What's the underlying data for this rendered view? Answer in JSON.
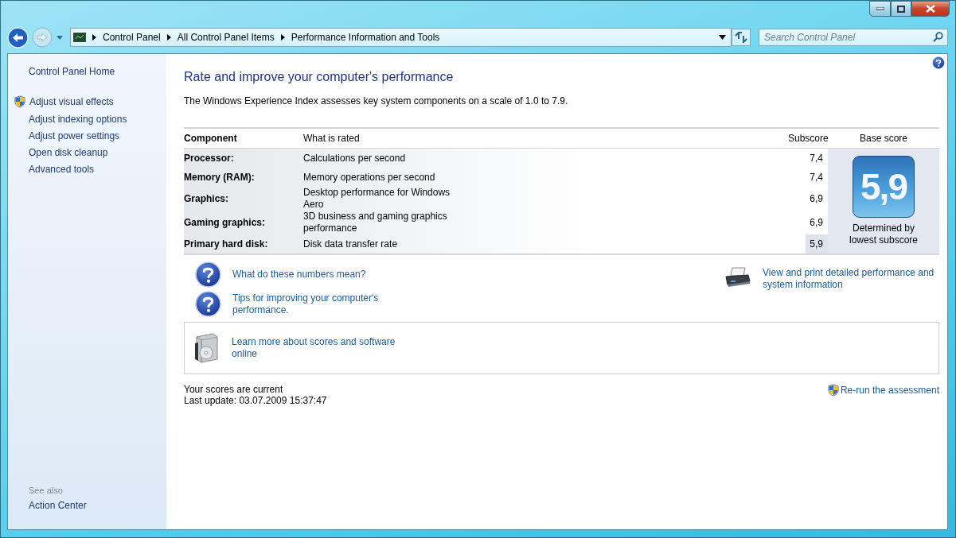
{
  "address_bar": {
    "breadcrumbs": [
      "Control Panel",
      "All Control Panel Items",
      "Performance Information and Tools"
    ]
  },
  "search": {
    "placeholder": "Search Control Panel"
  },
  "sidebar": {
    "home": "Control Panel Home",
    "items": [
      {
        "label": "Adjust visual effects",
        "kind": "shield"
      },
      {
        "label": "Adjust indexing options",
        "kind": "plain"
      },
      {
        "label": "Adjust power settings",
        "kind": "plain"
      },
      {
        "label": "Open disk cleanup",
        "kind": "plain"
      },
      {
        "label": "Advanced tools",
        "kind": "plain"
      }
    ],
    "see_also": {
      "heading": "See also",
      "items": [
        "Action Center"
      ]
    }
  },
  "main": {
    "title": "Rate and improve your computer's performance",
    "description": "The Windows Experience Index assesses key system components on a scale of 1.0 to 7.9.",
    "table": {
      "columns": [
        "Component",
        "What is rated",
        "Subscore",
        "Base score"
      ],
      "rows": [
        {
          "component": "Processor:",
          "rated": "Calculations per second",
          "subscore": "7,4",
          "lowest": false
        },
        {
          "component": "Memory (RAM):",
          "rated": "Memory operations per second",
          "subscore": "7,4",
          "lowest": false
        },
        {
          "component": "Graphics:",
          "rated": "Desktop performance for Windows Aero",
          "subscore": "6,9",
          "lowest": false
        },
        {
          "component": "Gaming graphics:",
          "rated": "3D business and gaming graphics performance",
          "subscore": "6,9",
          "lowest": false
        },
        {
          "component": "Primary hard disk:",
          "rated": "Disk data transfer rate",
          "subscore": "5,9",
          "lowest": true
        }
      ]
    },
    "base_score": {
      "value": "5,9",
      "caption": "Determined by lowest subscore"
    },
    "help_links": [
      "What do these numbers mean?",
      "Tips for improving your computer's performance."
    ],
    "print_link": "View and print detailed performance and system information",
    "online_link": "Learn more about scores and software online",
    "status": [
      "Your scores are current",
      "Last update: 03.07.2009 15:37:47"
    ],
    "rerun": "Re-run the assessment"
  }
}
